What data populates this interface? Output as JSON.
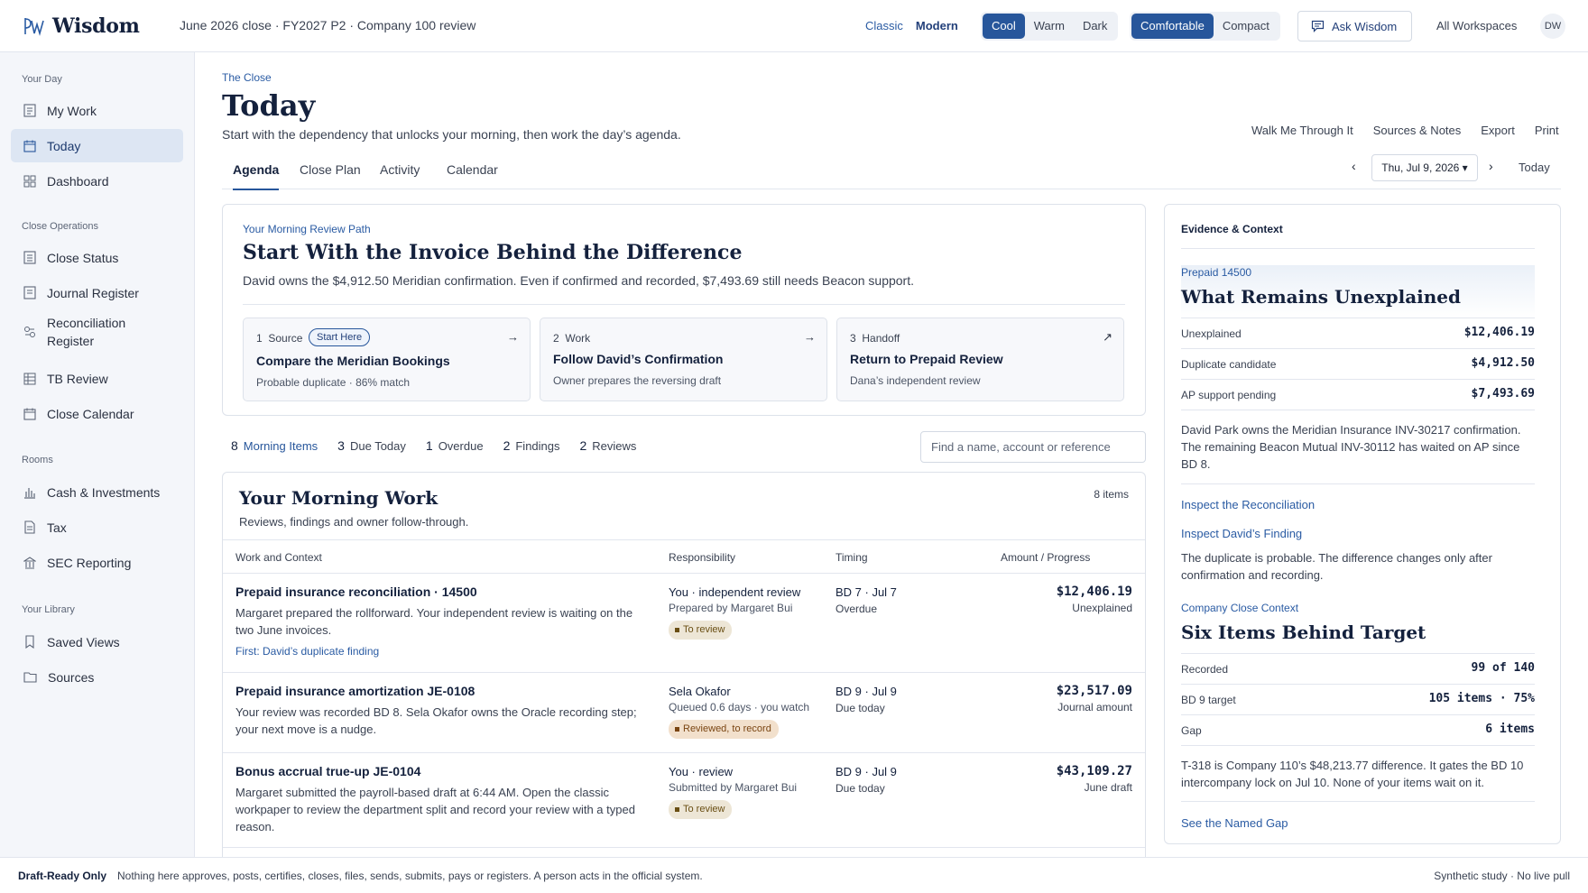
{
  "app": {
    "name": "Wisdom",
    "context": "June 2026 close · FY2027 P2 · Company 100 review"
  },
  "header": {
    "modes": [
      "Classic",
      "Modern"
    ],
    "themes": [
      "Cool",
      "Warm",
      "Dark"
    ],
    "density": [
      "Comfortable",
      "Compact"
    ],
    "ask_label": "Ask Wisdom",
    "workspaces": "All Workspaces",
    "avatar": "DW"
  },
  "sidebar": {
    "sections": [
      {
        "title": "Your Day",
        "items": [
          "My Work",
          "Today",
          "Dashboard"
        ]
      },
      {
        "title": "Close Operations",
        "items": [
          "Close Status",
          "Journal Register",
          "Reconciliation Register",
          "TB Review",
          "Close Calendar"
        ]
      },
      {
        "title": "Rooms",
        "items": [
          "Cash & Investments",
          "Tax",
          "SEC Reporting"
        ]
      },
      {
        "title": "Your Library",
        "items": [
          "Saved Views",
          "Sources"
        ]
      }
    ],
    "active": "Today"
  },
  "page": {
    "eyebrow": "The Close",
    "title": "Today",
    "subtitle": "Start with the dependency that unlocks your morning, then work the day’s agenda.",
    "actions": [
      "Walk Me Through It",
      "Sources & Notes",
      "Export",
      "Print"
    ],
    "tabs": [
      "Agenda",
      "Close Plan",
      "Activity",
      "Calendar"
    ],
    "date": "Thu, Jul 9, 2026 ▾",
    "today_label": "Today"
  },
  "path": {
    "eyebrow": "Your Morning Review Path",
    "title": "Start With the Invoice Behind the Difference",
    "desc": "David owns the $4,912.50 Meridian confirmation. Even if confirmed and recorded, $7,493.69 still needs Beacon support.",
    "steps": [
      {
        "num": "1",
        "kind": "Source",
        "pill": "Start Here",
        "title": "Compare the Meridian Bookings",
        "desc": "Probable duplicate · 86% match"
      },
      {
        "num": "2",
        "kind": "Work",
        "title": "Follow David’s Confirmation",
        "desc": "Owner prepares the reversing draft"
      },
      {
        "num": "3",
        "kind": "Handoff",
        "title": "Return to Prepaid Review",
        "desc": "Dana’s independent review"
      }
    ]
  },
  "counters": [
    {
      "n": "8",
      "label": "Morning Items"
    },
    {
      "n": "3",
      "label": "Due Today"
    },
    {
      "n": "1",
      "label": "Overdue"
    },
    {
      "n": "2",
      "label": "Findings"
    },
    {
      "n": "2",
      "label": "Reviews"
    }
  ],
  "search_placeholder": "Find a name, account or reference",
  "work": {
    "title": "Your Morning Work",
    "subtitle": "Reviews, findings and owner follow-through.",
    "count": "8 items",
    "columns": [
      "Work and Context",
      "Responsibility",
      "Timing",
      "Amount / Progress"
    ],
    "rows": [
      {
        "title": "Prepaid insurance reconciliation · 14500",
        "desc": "Margaret prepared the rollforward. Your independent review is waiting on the two June invoices.",
        "link": "First: David’s duplicate finding",
        "resp": "You · independent review",
        "resp_sub": "Prepared by Margaret Bui",
        "badge": "To review",
        "timing": "BD 7 · Jul 7",
        "timing_sub": "Overdue",
        "amount": "$12,406.19",
        "amount_sub": "Unexplained"
      },
      {
        "title": "Prepaid insurance amortization JE-0108",
        "desc": "Your review was recorded BD 8. Sela Okafor owns the Oracle recording step; your next move is a nudge.",
        "resp": "Sela Okafor",
        "resp_sub": "Queued 0.6 days · you watch",
        "badge": "Reviewed, to record",
        "timing": "BD 9 · Jul 9",
        "timing_sub": "Due today",
        "amount": "$23,517.09",
        "amount_sub": "Journal amount"
      },
      {
        "title": "Bonus accrual true-up JE-0104",
        "desc": "Margaret submitted the payroll-based draft at 6:44 AM. Open the classic workpaper to review the department split and record your review with a typed reason.",
        "resp": "You · review",
        "resp_sub": "Submitted by Margaret Bui",
        "badge": "To review",
        "timing": "BD 9 · Jul 9",
        "timing_sub": "Due today",
        "amount": "$43,109.27",
        "amount_sub": "June draft"
      }
    ]
  },
  "evidence": {
    "heading": "Evidence & Context",
    "sec1": {
      "eyebrow": "Prepaid 14500",
      "title": "What Remains Unexplained",
      "rows": [
        [
          "Unexplained",
          "$12,406.19"
        ],
        [
          "Duplicate candidate",
          "$4,912.50"
        ],
        [
          "AP support pending",
          "$7,493.69"
        ]
      ],
      "note": "David Park owns the Meridian Insurance INV-30217 confirmation. The remaining Beacon Mutual INV-30112 has waited on AP since BD 8.",
      "link1": "Inspect the Reconciliation",
      "link2": "Inspect David’s Finding",
      "note2": "The duplicate is probable. The difference changes only after confirmation and recording."
    },
    "sec2": {
      "eyebrow": "Company Close Context",
      "title": "Six Items Behind Target",
      "rows": [
        [
          "Recorded",
          "99 of 140"
        ],
        [
          "BD 9 target",
          "105 items · 75%"
        ],
        [
          "Gap",
          "6 items"
        ]
      ],
      "note": "T-318 is Company 110’s $48,213.77 difference. It gates the BD 10 intercompany lock on Jul 10. None of your items wait on it.",
      "link": "See the Named Gap"
    }
  },
  "footer": {
    "label": "Draft-Ready Only",
    "text": "Nothing here approves, posts, certifies, closes, files, sends, submits, pays or registers. A person acts in the official system.",
    "right": "Synthetic study · No live pull"
  },
  "colors": {
    "accent": "#27569b",
    "link": "#2a5ba3",
    "ink": "#14213d"
  }
}
